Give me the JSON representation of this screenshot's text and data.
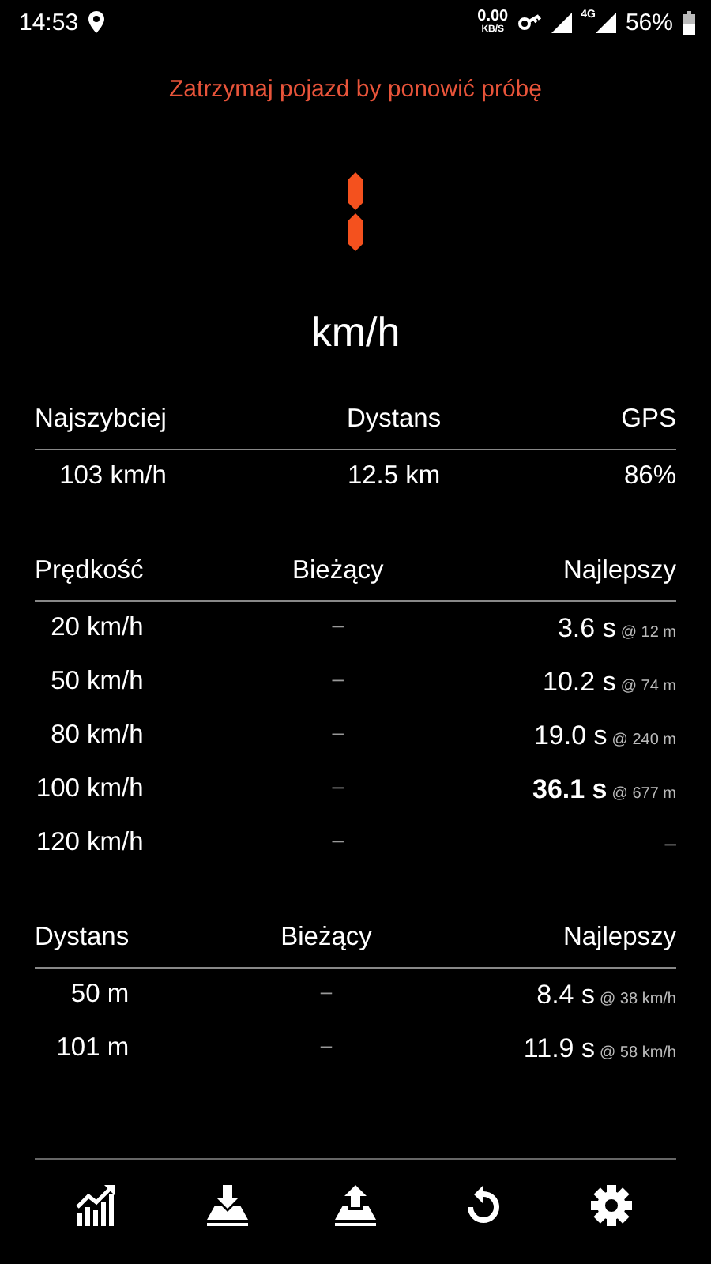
{
  "status_bar": {
    "time": "14:53",
    "net_speed": "0.00",
    "net_unit": "KB/S",
    "network": "4G",
    "battery": "56%"
  },
  "message": "Zatrzymaj pojazd by ponowić próbę",
  "speed": {
    "unit": "km/h"
  },
  "summary": {
    "columns": [
      "Najszybciej",
      "Dystans",
      "GPS"
    ],
    "values": [
      "103 km/h",
      "12.5 km",
      "86%"
    ]
  },
  "speed_table": {
    "columns": [
      "Prędkość",
      "Bieżący",
      "Najlepszy"
    ],
    "rows": [
      {
        "label": "20 km/h",
        "current": "–",
        "best": "3.6 s",
        "at": "@ 12 m",
        "highlighted": false
      },
      {
        "label": "50 km/h",
        "current": "–",
        "best": "10.2 s",
        "at": "@ 74 m",
        "highlighted": false
      },
      {
        "label": "80 km/h",
        "current": "–",
        "best": "19.0 s",
        "at": "@ 240 m",
        "highlighted": false
      },
      {
        "label": "100 km/h",
        "current": "–",
        "best": "36.1 s",
        "at": "@ 677 m",
        "highlighted": true
      },
      {
        "label": "120 km/h",
        "current": "–",
        "no_best": "–",
        "highlighted": false
      }
    ]
  },
  "distance_table": {
    "columns": [
      "Dystans",
      "Bieżący",
      "Najlepszy"
    ],
    "rows": [
      {
        "label": "50 m",
        "current": "–",
        "best": "8.4 s",
        "at": "@ 38 km/h",
        "highlighted": false
      },
      {
        "label": "101 m",
        "current": "–",
        "best": "11.9 s",
        "at": "@ 58 km/h",
        "highlighted": false
      }
    ]
  }
}
